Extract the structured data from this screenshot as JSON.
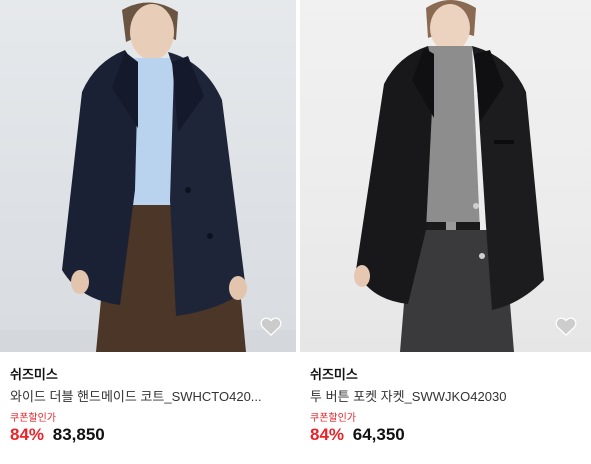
{
  "products": [
    {
      "brand": "쉬즈미스",
      "name": "와이드 더블 핸드메이드 코트_SWHCTO420...",
      "coupon_label": "쿠폰할인가",
      "discount": "84%",
      "price": "83,850"
    },
    {
      "brand": "쉬즈미스",
      "name": "투 버튼 포켓 자켓_SWWJKO42030",
      "coupon_label": "쿠폰할인가",
      "discount": "84%",
      "price": "64,350"
    }
  ],
  "icons": {
    "wishlist": "heart-icon"
  },
  "colors": {
    "accent_red": "#e8242b",
    "heart_fill": "#c8c8c8"
  }
}
